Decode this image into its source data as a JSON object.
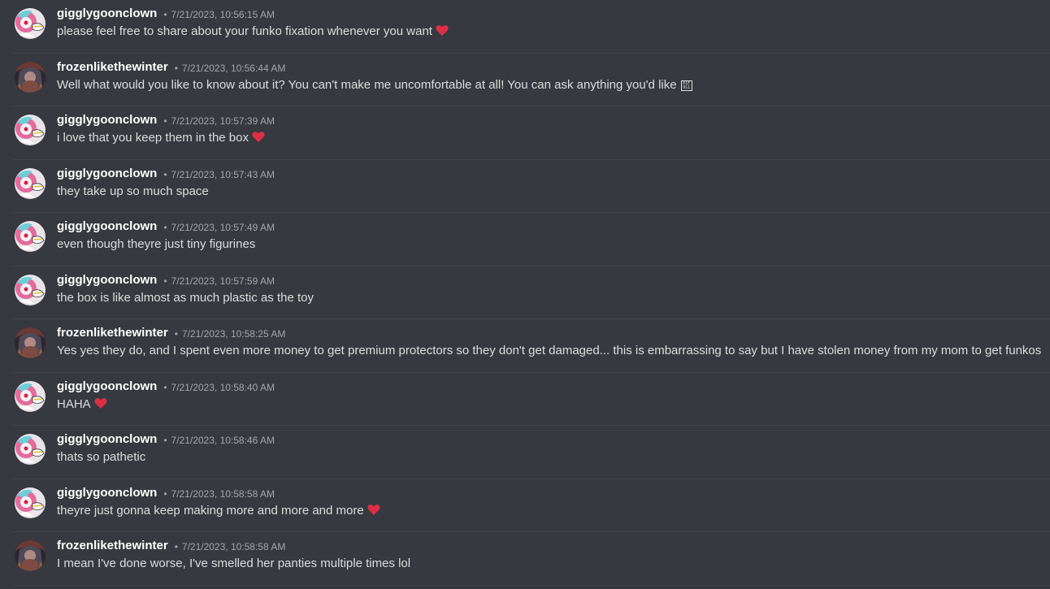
{
  "messages": [
    {
      "author": "gigglygoonclown",
      "timestamp": "7/21/2023, 10:56:15 AM",
      "text": "please feel free to share about your funko fixation whenever you want",
      "emoji": "heart",
      "avatar": "clown"
    },
    {
      "author": "frozenlikethewinter",
      "timestamp": "7/21/2023, 10:56:44 AM",
      "text": "Well what would you like to know about it? You can't make me uncomfortable at all! You can ask anything you'd like",
      "emoji": "unknown-glyph",
      "avatar": "winter"
    },
    {
      "author": "gigglygoonclown",
      "timestamp": "7/21/2023, 10:57:39 AM",
      "text": "i love that you keep them in the box",
      "emoji": "heart",
      "avatar": "clown"
    },
    {
      "author": "gigglygoonclown",
      "timestamp": "7/21/2023, 10:57:43 AM",
      "text": "they take up so much space",
      "emoji": "",
      "avatar": "clown"
    },
    {
      "author": "gigglygoonclown",
      "timestamp": "7/21/2023, 10:57:49 AM",
      "text": "even though theyre just tiny figurines",
      "emoji": "",
      "avatar": "clown"
    },
    {
      "author": "gigglygoonclown",
      "timestamp": "7/21/2023, 10:57:59 AM",
      "text": "the box is like almost as much plastic as the toy",
      "emoji": "",
      "avatar": "clown"
    },
    {
      "author": "frozenlikethewinter",
      "timestamp": "7/21/2023, 10:58:25 AM",
      "text": "Yes yes they do, and I spent even more money to get premium protectors so they don't get damaged... this is embarrassing to say but I have stolen money from my mom to get funkos",
      "emoji": "",
      "avatar": "winter"
    },
    {
      "author": "gigglygoonclown",
      "timestamp": "7/21/2023, 10:58:40 AM",
      "text": "HAHA",
      "emoji": "heart",
      "avatar": "clown"
    },
    {
      "author": "gigglygoonclown",
      "timestamp": "7/21/2023, 10:58:46 AM",
      "text": "thats so pathetic",
      "emoji": "",
      "avatar": "clown"
    },
    {
      "author": "gigglygoonclown",
      "timestamp": "7/21/2023, 10:58:58 AM",
      "text": "theyre just gonna keep making more and more and more",
      "emoji": "heart",
      "avatar": "clown"
    },
    {
      "author": "frozenlikethewinter",
      "timestamp": "7/21/2023, 10:58:58 AM",
      "text": "I mean I've done worse, I've smelled her panties multiple times lol",
      "emoji": "",
      "avatar": "winter"
    }
  ],
  "dot_separator": "•",
  "unknown_glyph_text": "01F\n911",
  "colors": {
    "background": "#36393f",
    "author": "#ffffff",
    "text": "#dcddde",
    "timestamp": "#a3a6aa",
    "heart": "#dd2e44",
    "divider": "#42454b"
  }
}
